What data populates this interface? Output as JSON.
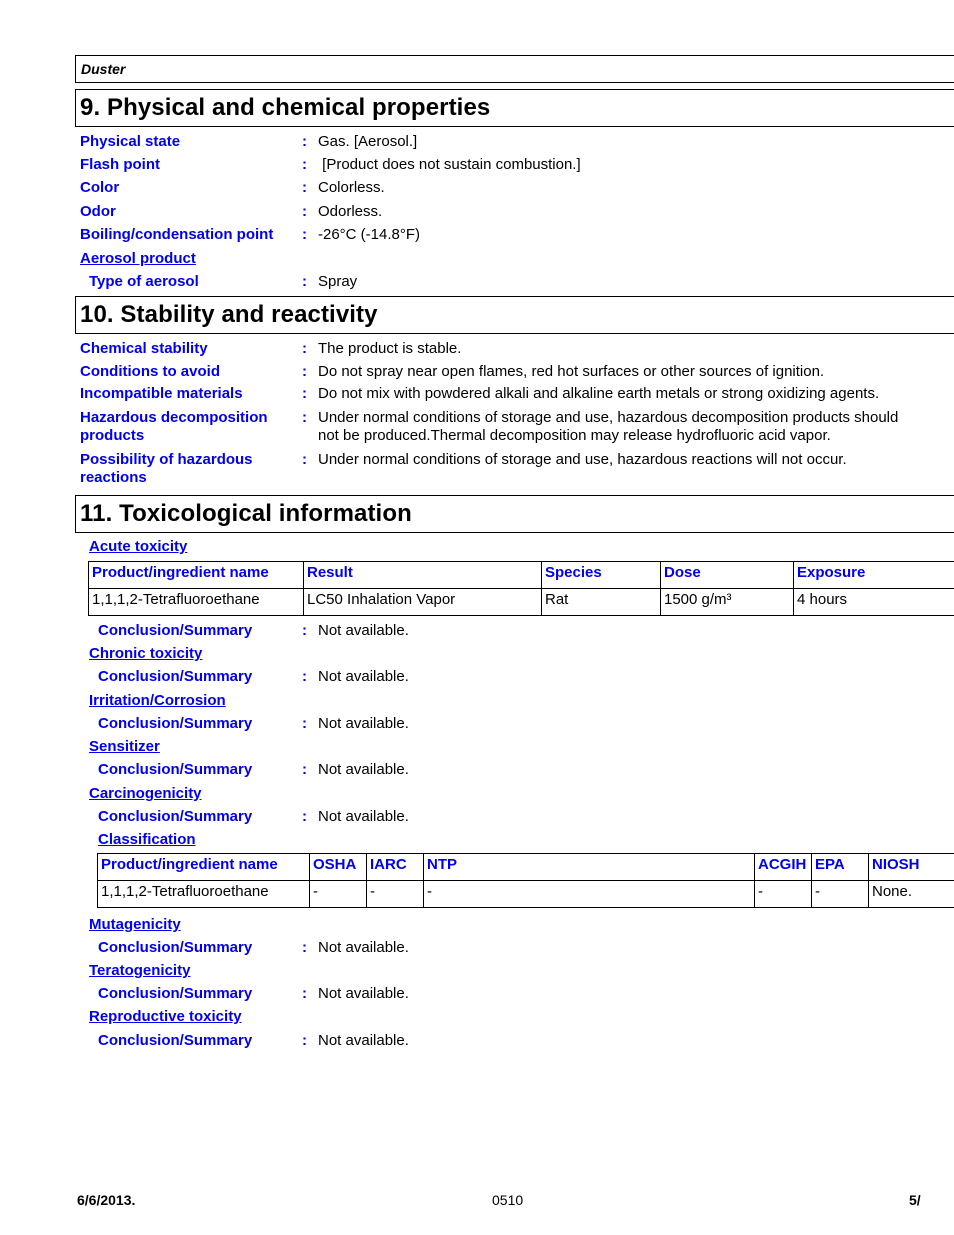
{
  "header": {
    "product_name": "Duster"
  },
  "section9": {
    "title": "9. Physical and chemical properties",
    "rows": [
      {
        "label": "Physical state",
        "value": "Gas. [Aerosol.]"
      },
      {
        "label": "Flash point",
        "value": " [Product does not sustain combustion.]"
      },
      {
        "label": "Color",
        "value": "Colorless."
      },
      {
        "label": "Odor",
        "value": "Odorless."
      },
      {
        "label": "Boiling/condensation point",
        "value": "-26°C (-14.8°F)"
      }
    ],
    "aerosol_heading": "Aerosol product",
    "aerosol_rows": [
      {
        "label": "Type of aerosol",
        "value": "Spray"
      }
    ]
  },
  "section10": {
    "title": "10. Stability and reactivity",
    "rows": [
      {
        "label": "Chemical stability",
        "value": "The product is stable."
      },
      {
        "label": "Conditions to avoid",
        "value": "Do not spray near open flames, red hot surfaces or other sources of ignition."
      },
      {
        "label": "Incompatible materials",
        "value": "Do not mix with powdered alkali and alkaline earth metals or strong oxidizing agents."
      },
      {
        "label_line1": "Hazardous decomposition",
        "label_line2": "products",
        "value_line1": "Under normal conditions of storage and use, hazardous decomposition products should",
        "value_line2": "not be produced.Thermal decomposition may release hydrofluoric acid vapor."
      },
      {
        "label_line1": "Possibility of hazardous",
        "label_line2": "reactions",
        "value": "Under normal conditions of storage and use, hazardous reactions will not occur."
      }
    ]
  },
  "section11": {
    "title": "11. Toxicological information",
    "acute_toxicity": {
      "heading": "Acute toxicity",
      "columns": [
        "Product/ingredient name",
        "Result",
        "Species",
        "Dose",
        "Exposure"
      ],
      "rows": [
        [
          "1,1,1,2-Tetrafluoroethane",
          "LC50 Inhalation Vapor",
          "Rat",
          "1500 g/m³",
          "4 hours"
        ]
      ],
      "conclusion_label": "Conclusion/Summary",
      "conclusion_value": "Not available."
    },
    "chronic_toxicity": {
      "heading": "Chronic toxicity",
      "conclusion_label": "Conclusion/Summary",
      "conclusion_value": "Not available."
    },
    "irritation": {
      "heading": "Irritation/Corrosion",
      "conclusion_label": "Conclusion/Summary",
      "conclusion_value": "Not available."
    },
    "sensitizer": {
      "heading": "Sensitizer",
      "conclusion_label": "Conclusion/Summary",
      "conclusion_value": "Not available."
    },
    "carcinogenicity": {
      "heading": "Carcinogenicity",
      "conclusion_label": "Conclusion/Summary",
      "conclusion_value": "Not available.",
      "classification_heading": "Classification",
      "columns": [
        "Product/ingredient name",
        "OSHA",
        "IARC",
        "NTP",
        "ACGIH",
        "EPA",
        "NIOSH"
      ],
      "rows": [
        [
          "1,1,1,2-Tetrafluoroethane",
          "-",
          "-",
          "-",
          "-",
          "-",
          "None."
        ]
      ]
    },
    "mutagenicity": {
      "heading": "Mutagenicity",
      "conclusion_label": "Conclusion/Summary",
      "conclusion_value": "Not available."
    },
    "teratogenicity": {
      "heading": "Teratogenicity",
      "conclusion_label": "Conclusion/Summary",
      "conclusion_value": "Not available."
    },
    "reproductive": {
      "heading": "Reproductive toxicity",
      "conclusion_label": "Conclusion/Summary",
      "conclusion_value": "Not available."
    }
  },
  "footer": {
    "date": "6/6/2013.",
    "code": "0510",
    "page": "5/"
  },
  "colors": {
    "label_blue": "#0000ee",
    "text": "#000000",
    "rule": "#000000"
  }
}
